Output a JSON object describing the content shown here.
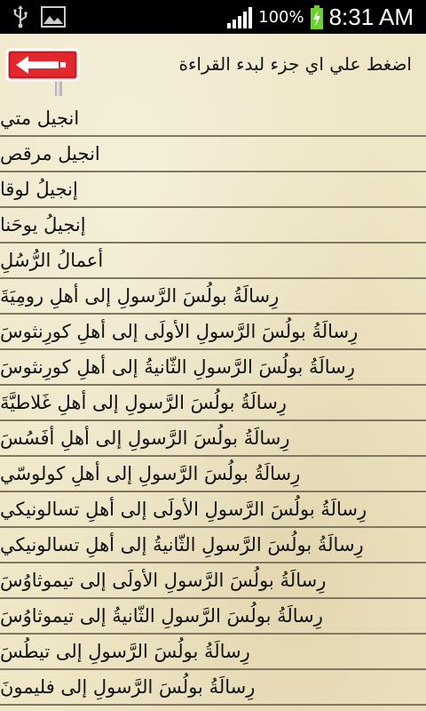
{
  "status_bar": {
    "battery_pct": "100%",
    "time": "8:31 AM",
    "icons": [
      "usb-icon",
      "image-icon",
      "signal-icon",
      "battery-charging-icon"
    ]
  },
  "header": {
    "instruction": "اضغط علي اي جزء لبدء القراءة",
    "back_icon": "back-arrow-sign-icon"
  },
  "books": [
    "انجيل متي",
    "انجيل مرقص",
    "إنجيلُ لوقا",
    "إنجيلُ يوحَنا",
    "أعمالُ الرُّسُلِ",
    "رِسالَةُ بولُسَ الرَّسولِ إلى أهلِ رومِيَةَ",
    "رِسالَةُ بولُسَ الرَّسولِ الأولَى إلى أهلِ كورِنثوسَ",
    "رِسالَةُ بولُسَ الرَّسولِ الثّانيةُ إلى أهلِ كورِنثوسَ",
    "رِسالَةُ بولُسَ الرَّسولِ إلى أهلِ غَلاطيَّةَ",
    "رِسالَةُ بولُسَ الرَّسولِ إلى أهلِ أفَسُسَ",
    "رِسالَةُ بولُسَ الرَّسولِ إلى أهلِ كولوسّي",
    "رِسالَةُ بولُسَ الرَّسولِ الأولَى إلى أهلِ تسالونيكي",
    "رِسالَةُ بولُسَ الرَّسولِ الثّانيةُ إلى أهلِ تسالونيكي",
    "رِسالَةُ بولُسَ الرَّسولِ الأولَى إلى تيموثاوُسَ",
    "رِسالَةُ بولُسَ الرَّسولِ الثّانيةُ إلى تيموثاوُسَ",
    "رِسالَةُ بولُسَ الرَّسولِ إلى تيطُسَ",
    "رِسالَةُ بولُسَ الرَّسولِ إلى فليمونَ"
  ],
  "colors": {
    "background": "#efe6c6",
    "divider": "#7f7860",
    "sign_red": "#e0282e"
  }
}
